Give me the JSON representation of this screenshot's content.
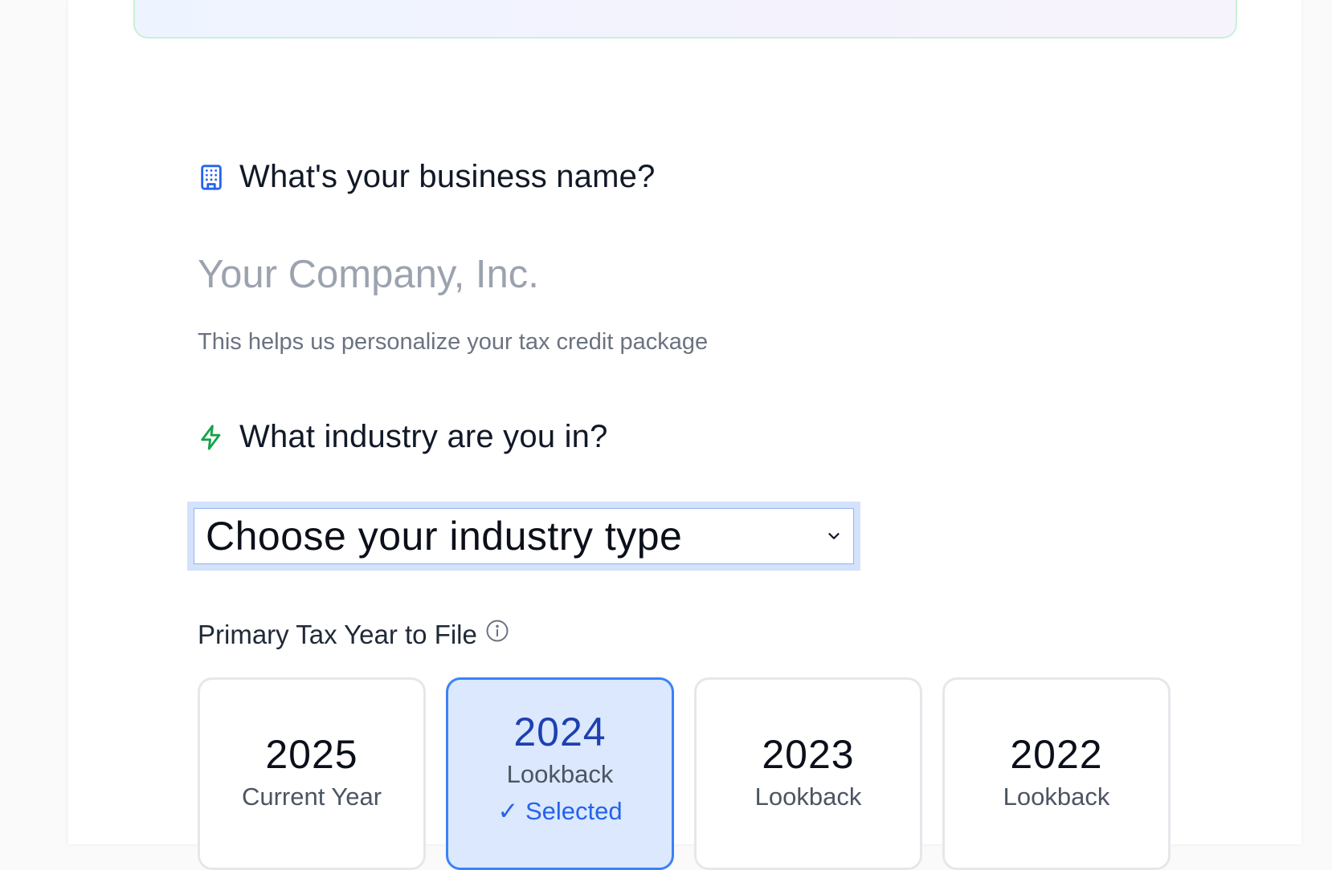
{
  "business": {
    "question": "What's your business name?",
    "placeholder": "Your Company, Inc.",
    "helper": "This helps us personalize your tax credit package",
    "icon": "building-icon"
  },
  "industry": {
    "question": "What industry are you in?",
    "selected_value": "Choose your industry type",
    "icon": "lightning-icon"
  },
  "tax_year": {
    "label": "Primary Tax Year to File",
    "info_icon": "info-icon",
    "options": [
      {
        "year": "2025",
        "sub": "Current Year",
        "selected": false
      },
      {
        "year": "2024",
        "sub": "Lookback",
        "selected": true,
        "selected_text": "✓ Selected"
      },
      {
        "year": "2023",
        "sub": "Lookback",
        "selected": false
      },
      {
        "year": "2022",
        "sub": "Lookback",
        "selected": false
      }
    ]
  },
  "colors": {
    "accent": "#3b82f6",
    "selected_bg": "#dbe8fd",
    "icon_blue": "#2563eb",
    "icon_green": "#16a34a"
  }
}
